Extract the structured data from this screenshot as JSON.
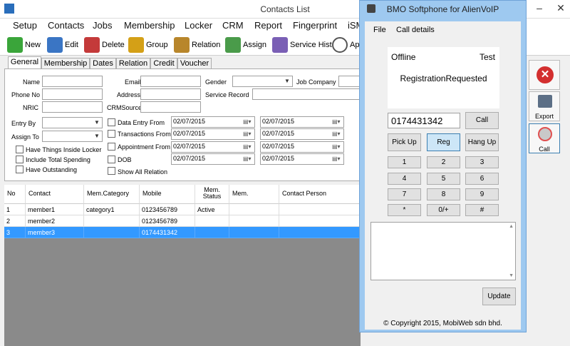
{
  "main": {
    "title": "Contacts List",
    "menu": [
      "Setup",
      "Contacts",
      "Jobs",
      "Membership",
      "Locker",
      "CRM",
      "Report",
      "Fingerprint",
      "iSMS"
    ],
    "toolbar": [
      "New",
      "Edit",
      "Delete",
      "Group",
      "Relation",
      "Assign",
      "Service Hist",
      "Ap"
    ],
    "tabs": [
      "General",
      "Membership",
      "Dates",
      "Relation",
      "Credit",
      "Voucher"
    ],
    "form": {
      "name": "Name",
      "phone_no": "Phone No",
      "nric": "NRIC",
      "email": "Email",
      "address": "Address",
      "crmsource": "CRMSource",
      "gender": "Gender",
      "job_company": "Job Company",
      "service_record": "Service Record",
      "entry_by": "Entry By",
      "assign_to": "Assign To",
      "have_things": "Have Things Inside Locker",
      "include_spending": "Include Total Spending",
      "have_outstanding": "Have Outstanding",
      "data_entry_from": "Data Entry From",
      "transactions_from": "Transactions From",
      "appointment_from": "Appointment From",
      "dob": "DOB",
      "show_all_relation": "Show All Relation",
      "date_value": "02/07/2015"
    },
    "grid": {
      "headers": [
        "No",
        "Contact",
        "Mem.Category",
        "Mobile",
        "Mem. Status",
        "Mem.",
        "Contact Person"
      ],
      "rows": [
        [
          "1",
          "member1",
          "category1",
          "0123456789",
          "Active"
        ],
        [
          "2",
          "member2",
          "",
          "0123456789",
          ""
        ],
        [
          "3",
          "member3",
          "",
          "0174431342",
          ""
        ]
      ]
    },
    "side_buttons": {
      "export": "Export",
      "call": "Call"
    }
  },
  "phone": {
    "title": "BMO Softphone for AlienVoIP",
    "menu": [
      "File",
      "Call details"
    ],
    "status_left": "Offline",
    "status_right": "Test",
    "registration": "RegistrationRequested",
    "number": "0174431342",
    "call": "Call",
    "pickup": "Pick Up",
    "reg": "Reg",
    "hangup": "Hang Up",
    "keys": [
      "1",
      "2",
      "3",
      "4",
      "5",
      "6",
      "7",
      "8",
      "9",
      "*",
      "0/+",
      "#"
    ],
    "update": "Update",
    "copyright": "© Copyright 2015, MobiWeb sdn bhd."
  },
  "colors": {
    "selection": "#3399ff",
    "phone_frame": "#9ec9f0"
  }
}
